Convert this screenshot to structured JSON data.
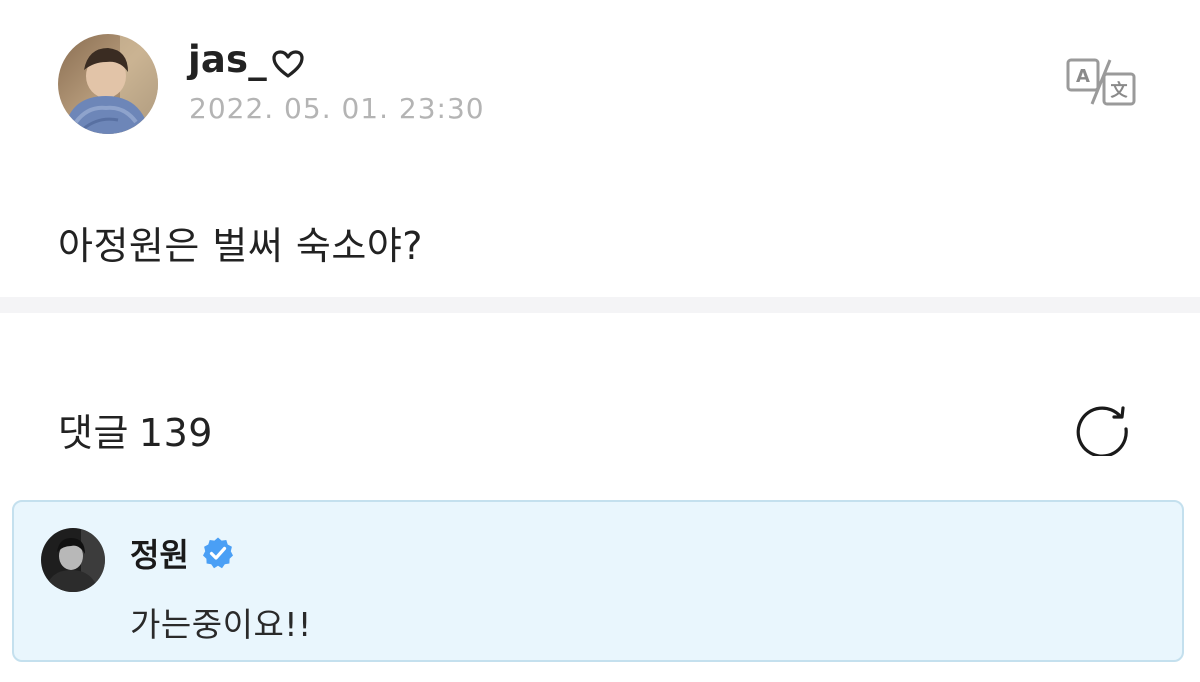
{
  "post": {
    "author_name": "jas_",
    "author_name_icon": "heart-outline-icon",
    "date": "2022. 05. 01. 23:30",
    "translate_icon": "translate-icon",
    "body": "아정원은 벌써 숙소야?"
  },
  "comments": {
    "label": "댓글",
    "count": "139",
    "refresh_icon": "refresh-icon",
    "items": [
      {
        "author_name": "정원",
        "badge_icon": "verified-badge-icon",
        "text": "가는중이요!!"
      }
    ]
  },
  "colors": {
    "date_text": "#b4b4b4",
    "divider": "#f4f4f6",
    "comment_card_bg": "#e9f6fd",
    "comment_card_border": "#c4e0ee",
    "verified_badge": "#4a9ff5"
  }
}
